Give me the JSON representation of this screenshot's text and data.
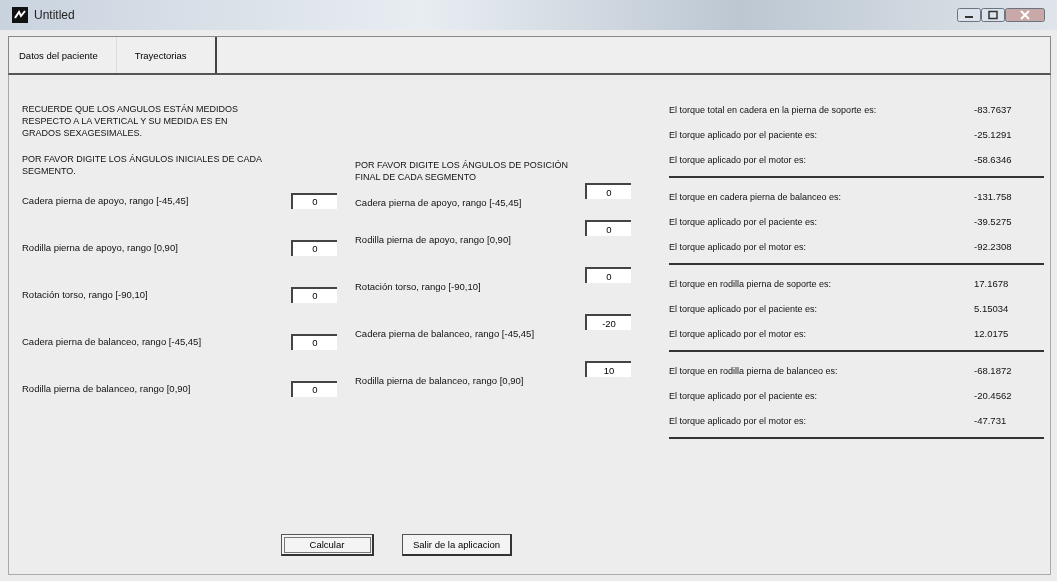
{
  "window": {
    "title": "Untitled"
  },
  "tabs": [
    {
      "label": "Datos del paciente",
      "selected": false
    },
    {
      "label": "Trayectorias",
      "selected": true
    }
  ],
  "initial": {
    "note": "RECUERDE QUE LOS ANGULOS ESTÁN MEDIDOS RESPECTO A LA VERTICAL Y SU MEDIDA ES EN GRADOS SEXAGESIMALES.",
    "heading": "POR FAVOR DIGITE LOS ÁNGULOS INICIALES DE CADA SEGMENTO.",
    "fields": [
      {
        "label": "Cadera pierna de apoyo, rango [-45,45]",
        "value": "0"
      },
      {
        "label": "Rodilla pierna de apoyo, rango [0,90]",
        "value": "0"
      },
      {
        "label": "Rotación torso, rango [-90,10]",
        "value": "0"
      },
      {
        "label": "Cadera pierna de balanceo, rango [-45,45]",
        "value": "0"
      },
      {
        "label": "Rodilla pierna de balanceo, rango [0,90]",
        "value": "0"
      }
    ]
  },
  "final": {
    "heading": "POR FAVOR DIGITE LOS ÁNGULOS DE POSICIÓN FINAL DE CADA SEGMENTO",
    "fields": [
      {
        "label": "Cadera pierna de apoyo, rango [-45,45]",
        "value": "0"
      },
      {
        "label": "Rodilla pierna de apoyo, rango [0,90]",
        "value": "0"
      },
      {
        "label": "Rotación torso, rango [-90,10]",
        "value": "0"
      },
      {
        "label": "Cadera pierna de balanceo, rango [-45,45]",
        "value": "-20"
      },
      {
        "label": "Rodilla pierna de balanceo, rango [0,90]",
        "value": "10"
      }
    ]
  },
  "results": [
    {
      "rows": [
        {
          "label": "El torque total en cadera en la pierna de soporte es:",
          "value": "-83.7637"
        },
        {
          "label": "El torque aplicado por el paciente es:",
          "value": "-25.1291"
        },
        {
          "label": "El torque aplicado por el motor es:",
          "value": "-58.6346"
        }
      ]
    },
    {
      "rows": [
        {
          "label": "El torque en cadera pierna de balanceo es:",
          "value": "-131.758"
        },
        {
          "label": "El torque aplicado por el paciente es:",
          "value": "-39.5275"
        },
        {
          "label": "El torque aplicado por el motor es:",
          "value": "-92.2308"
        }
      ]
    },
    {
      "rows": [
        {
          "label": "El torque en rodilla pierna de soporte es:",
          "value": "17.1678"
        },
        {
          "label": "El torque aplicado por el paciente es:",
          "value": "5.15034"
        },
        {
          "label": "El torque aplicado por el motor es:",
          "value": "12.0175"
        }
      ]
    },
    {
      "rows": [
        {
          "label": "El torque en rodilla pierna de balanceo es:",
          "value": "-68.1872"
        },
        {
          "label": "El torque aplicado por el paciente es:",
          "value": "-20.4562"
        },
        {
          "label": "El torque aplicado por el motor es:",
          "value": "-47.731"
        }
      ]
    }
  ],
  "buttons": [
    "Calcular",
    "Salir de la aplicacion"
  ]
}
